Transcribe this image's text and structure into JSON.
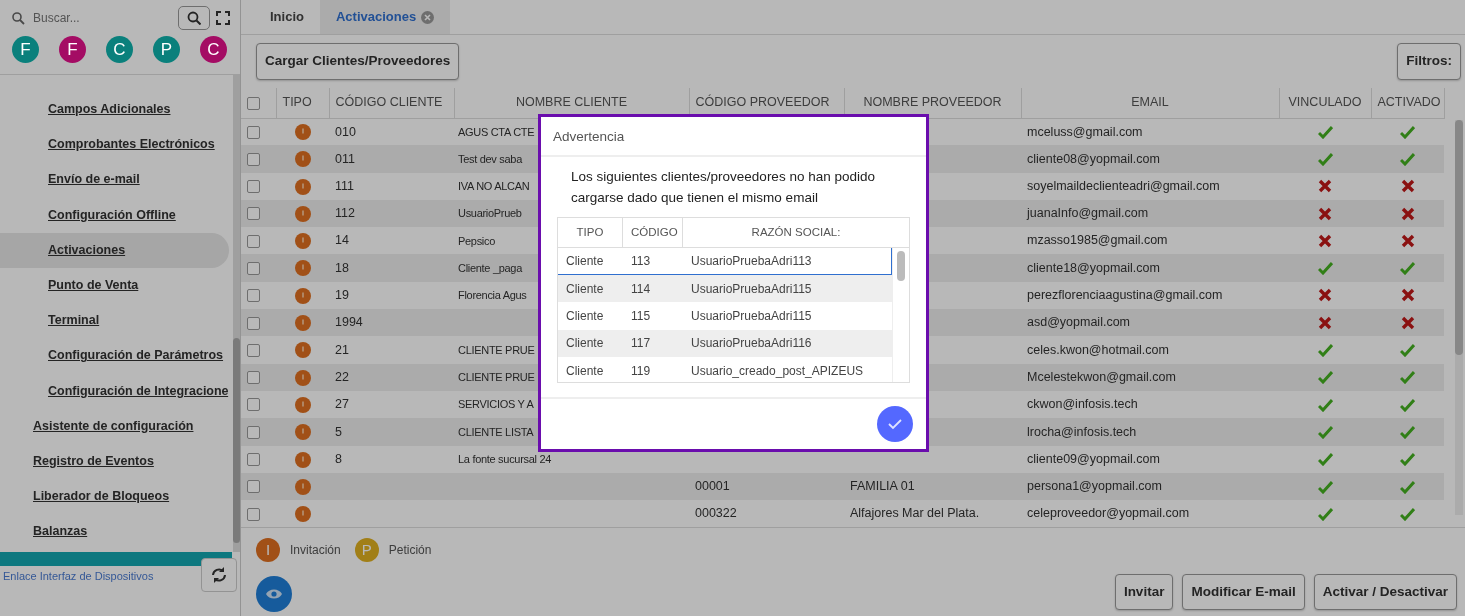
{
  "sidebar": {
    "search": {
      "placeholder": "Buscar..."
    },
    "avatars": [
      {
        "letter": "F",
        "color": "#0a807c"
      },
      {
        "letter": "F",
        "color": "#a40c64"
      },
      {
        "letter": "C",
        "color": "#0a807c"
      },
      {
        "letter": "P",
        "color": "#0a807c"
      },
      {
        "letter": "C",
        "color": "#a40c64"
      }
    ],
    "items": [
      {
        "label": "Campos Adicionales",
        "kind": "sub",
        "selected": false
      },
      {
        "label": "Comprobantes Electrónicos",
        "kind": "sub",
        "selected": false
      },
      {
        "label": "Envío de e-mail",
        "kind": "sub",
        "selected": false
      },
      {
        "label": "Configuración Offline",
        "kind": "sub",
        "selected": false
      },
      {
        "label": "Activaciones",
        "kind": "sub",
        "selected": true
      },
      {
        "label": "Punto de Venta",
        "kind": "sub",
        "selected": false
      },
      {
        "label": "Terminal",
        "kind": "sub",
        "selected": false
      },
      {
        "label": "Configuración de Parámetros",
        "kind": "sub",
        "selected": false
      },
      {
        "label": "Configuración de Integracione",
        "kind": "sub",
        "selected": false
      },
      {
        "label": "Asistente de configuración",
        "kind": "main",
        "selected": false
      },
      {
        "label": "Registro de Eventos",
        "kind": "main",
        "selected": false
      },
      {
        "label": "Liberador de Bloqueos",
        "kind": "main",
        "selected": false
      },
      {
        "label": "Balanzas",
        "kind": "main",
        "selected": false
      }
    ],
    "footer_link": "Enlace Interfaz de Dispositivos"
  },
  "tabs": [
    {
      "label": "Inicio",
      "selected": false,
      "closable": false
    },
    {
      "label": "Activaciones",
      "selected": true,
      "closable": true
    }
  ],
  "toolbar": {
    "load_button": "Cargar Clientes/Proveedores",
    "filter_button": "Filtros:"
  },
  "table": {
    "all_checked": false,
    "columns": [
      "TIPO",
      "CÓDIGO CLIENTE",
      "NOMBRE CLIENTE",
      "CÓDIGO PROVEEDOR",
      "NOMBRE PROVEEDOR",
      "EMAIL",
      "VINCULADO",
      "ACTIVADO"
    ],
    "rows": [
      {
        "kind": "invitation",
        "checked": false,
        "codigo_cliente": "010",
        "nombre_cliente": "AGUS CTA CTE",
        "codigo_proveedor": "",
        "nombre_proveedor": "",
        "email": "mceluss@gmail.com",
        "vinculado": true,
        "activado": true
      },
      {
        "kind": "invitation",
        "checked": false,
        "codigo_cliente": "011",
        "nombre_cliente": "Test dev saba",
        "codigo_proveedor": "",
        "nombre_proveedor": "",
        "email": "cliente08@yopmail.com",
        "vinculado": true,
        "activado": true
      },
      {
        "kind": "invitation",
        "checked": false,
        "codigo_cliente": "111",
        "nombre_cliente": "IVA NO ALCAN",
        "codigo_proveedor": "",
        "nombre_proveedor": "",
        "email": "soyelmaildeclienteadri@gmail.com",
        "vinculado": false,
        "activado": false
      },
      {
        "kind": "invitation",
        "checked": false,
        "codigo_cliente": "112",
        "nombre_cliente": "UsuarioPrueb",
        "codigo_proveedor": "",
        "nombre_proveedor": "",
        "email": "juanaInfo@gmail.com",
        "vinculado": false,
        "activado": false
      },
      {
        "kind": "invitation",
        "checked": false,
        "codigo_cliente": "14",
        "nombre_cliente": "Pepsico",
        "codigo_proveedor": "",
        "nombre_proveedor": "",
        "email": "mzasso1985@gmail.com",
        "vinculado": false,
        "activado": false
      },
      {
        "kind": "invitation",
        "checked": false,
        "codigo_cliente": "18",
        "nombre_cliente": "Cliente _paga",
        "codigo_proveedor": "",
        "nombre_proveedor": "",
        "email": "cliente18@yopmail.com",
        "vinculado": true,
        "activado": true
      },
      {
        "kind": "invitation",
        "checked": false,
        "codigo_cliente": "19",
        "nombre_cliente": "Florencia Agus",
        "codigo_proveedor": "",
        "nombre_proveedor": "",
        "email": "perezflorenciaagustina@gmail.com",
        "vinculado": false,
        "activado": false
      },
      {
        "kind": "invitation",
        "checked": false,
        "codigo_cliente": "1994",
        "nombre_cliente": "",
        "codigo_proveedor": "",
        "nombre_proveedor": "",
        "email": "asd@yopmail.com",
        "vinculado": false,
        "activado": false
      },
      {
        "kind": "invitation",
        "checked": false,
        "codigo_cliente": "21",
        "nombre_cliente": "CLIENTE PRUE",
        "codigo_proveedor": "",
        "nombre_proveedor": "",
        "email": "celes.kwon@hotmail.com",
        "vinculado": true,
        "activado": true
      },
      {
        "kind": "invitation",
        "checked": false,
        "codigo_cliente": "22",
        "nombre_cliente": "CLIENTE PRUE",
        "codigo_proveedor": "",
        "nombre_proveedor": "",
        "email": "Mcelestekwon@gmail.com",
        "vinculado": true,
        "activado": true
      },
      {
        "kind": "invitation",
        "checked": false,
        "codigo_cliente": "27",
        "nombre_cliente": "SERVICIOS Y A",
        "codigo_proveedor": "",
        "nombre_proveedor": "",
        "email": "ckwon@infosis.tech",
        "vinculado": true,
        "activado": true
      },
      {
        "kind": "invitation",
        "checked": false,
        "codigo_cliente": "5",
        "nombre_cliente": "CLIENTE LISTA",
        "codigo_proveedor": "",
        "nombre_proveedor": "",
        "email": "lrocha@infosis.tech",
        "vinculado": true,
        "activado": true
      },
      {
        "kind": "invitation",
        "checked": false,
        "codigo_cliente": "8",
        "nombre_cliente": "La fonte sucursal 24",
        "codigo_proveedor": "",
        "nombre_proveedor": "",
        "email": "cliente09@yopmail.com",
        "vinculado": true,
        "activado": true
      },
      {
        "kind": "invitation",
        "checked": false,
        "codigo_cliente": "",
        "nombre_cliente": "",
        "codigo_proveedor": "00001",
        "nombre_proveedor": "FAMILIA 01",
        "email": "persona1@yopmail.com",
        "vinculado": true,
        "activado": true
      },
      {
        "kind": "invitation",
        "checked": false,
        "codigo_cliente": "",
        "nombre_cliente": "",
        "codigo_proveedor": "000322",
        "nombre_proveedor": "Alfajores Mar del Plata.",
        "email": "celeproveedor@yopmail.com",
        "vinculado": true,
        "activado": true
      }
    ]
  },
  "legend": [
    {
      "kind": "invitation",
      "letter": "I",
      "label": "Invitación"
    },
    {
      "kind": "request",
      "letter": "P",
      "label": "Petición"
    }
  ],
  "actions": [
    "Invitar",
    "Modificar E-mail",
    "Activar / Desactivar"
  ],
  "dialog": {
    "title": "Advertencia",
    "message": "Los siguientes clientes/proveedores no han podido cargarse dado que tienen el mismo email",
    "columns": [
      "TIPO",
      "CÓDIGO",
      "RAZÓN SOCIAL:"
    ],
    "rows": [
      {
        "tipo": "Cliente",
        "codigo": "113",
        "razon": "UsuarioPruebaAdri113",
        "selected": true
      },
      {
        "tipo": "Cliente",
        "codigo": "114",
        "razon": "UsuarioPruebaAdri115",
        "selected": false
      },
      {
        "tipo": "Cliente",
        "codigo": "115",
        "razon": "UsuarioPruebaAdri115",
        "selected": false
      },
      {
        "tipo": "Cliente",
        "codigo": "117",
        "razon": "UsuarioPruebaAdri116",
        "selected": false
      },
      {
        "tipo": "Cliente",
        "codigo": "119",
        "razon": "Usuario_creado_post_APIZEUS",
        "selected": false
      }
    ]
  }
}
